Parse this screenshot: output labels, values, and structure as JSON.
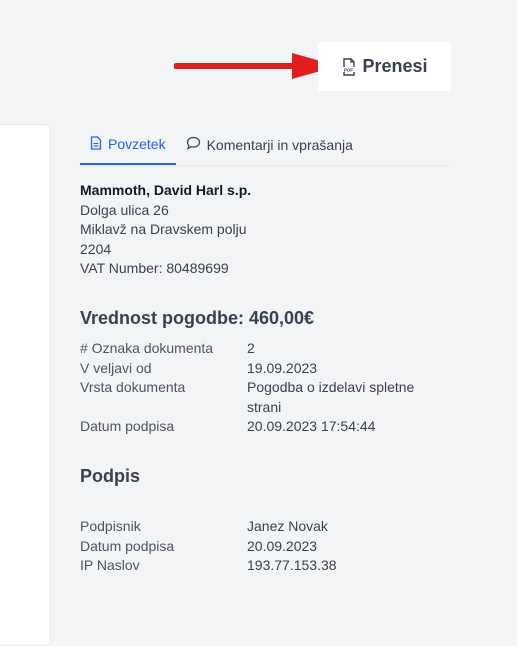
{
  "header": {
    "download_label": "Prenesi",
    "download_icon": "pdf-file-icon",
    "arrow_color": "#e11d1d"
  },
  "tabs": [
    {
      "label": "Povzetek",
      "icon": "document-icon",
      "active": true
    },
    {
      "label": "Komentarji in vprašanja",
      "icon": "comment-icon",
      "active": false
    }
  ],
  "company": {
    "name": "Mammoth, David Harl s.p.",
    "street": "Dolga ulica 26",
    "city": "Miklavž na Dravskem polju",
    "postcode": "2204",
    "vat": "VAT Number: 80489699"
  },
  "contract": {
    "title": "Vrednost pogodbe: 460,00€",
    "rows": [
      {
        "label": "# Oznaka dokumenta",
        "value": "2"
      },
      {
        "label": "V veljavi od",
        "value": "19.09.2023"
      },
      {
        "label": "Vrsta dokumenta",
        "value": "Pogodba o izdelavi spletne strani"
      },
      {
        "label": "Datum podpisa",
        "value": "20.09.2023 17:54:44"
      }
    ]
  },
  "signature": {
    "title": "Podpis",
    "rows": [
      {
        "label": "Podpisnik",
        "value": "Janez Novak"
      },
      {
        "label": "Datum podpisa",
        "value": "20.09.2023"
      },
      {
        "label": "IP Naslov",
        "value": "193.77.153.38"
      }
    ]
  }
}
